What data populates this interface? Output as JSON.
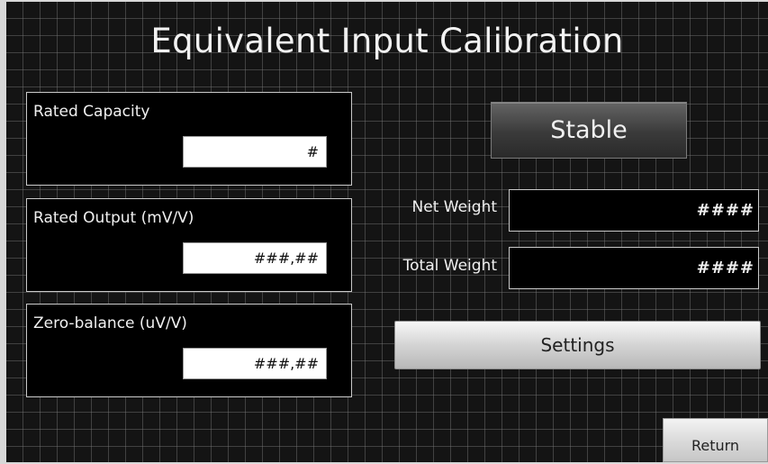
{
  "title": "Equivalent Input Calibration",
  "panels": [
    {
      "label": "Rated Capacity",
      "value": "#"
    },
    {
      "label": "Rated Output (mV/V)",
      "value": "###,##"
    },
    {
      "label": "Zero-balance (uV/V)",
      "value": "###,##"
    }
  ],
  "status": {
    "label": "Stable"
  },
  "net_weight": {
    "label": "Net Weight",
    "value": "####"
  },
  "total_weight": {
    "label": "Total Weight",
    "value": "####"
  },
  "buttons": {
    "settings": "Settings",
    "return": "Return"
  },
  "colors": {
    "background": "#141414",
    "grid": "#5a5a5a",
    "panel": "#000000",
    "text": "#f0f0f0"
  }
}
